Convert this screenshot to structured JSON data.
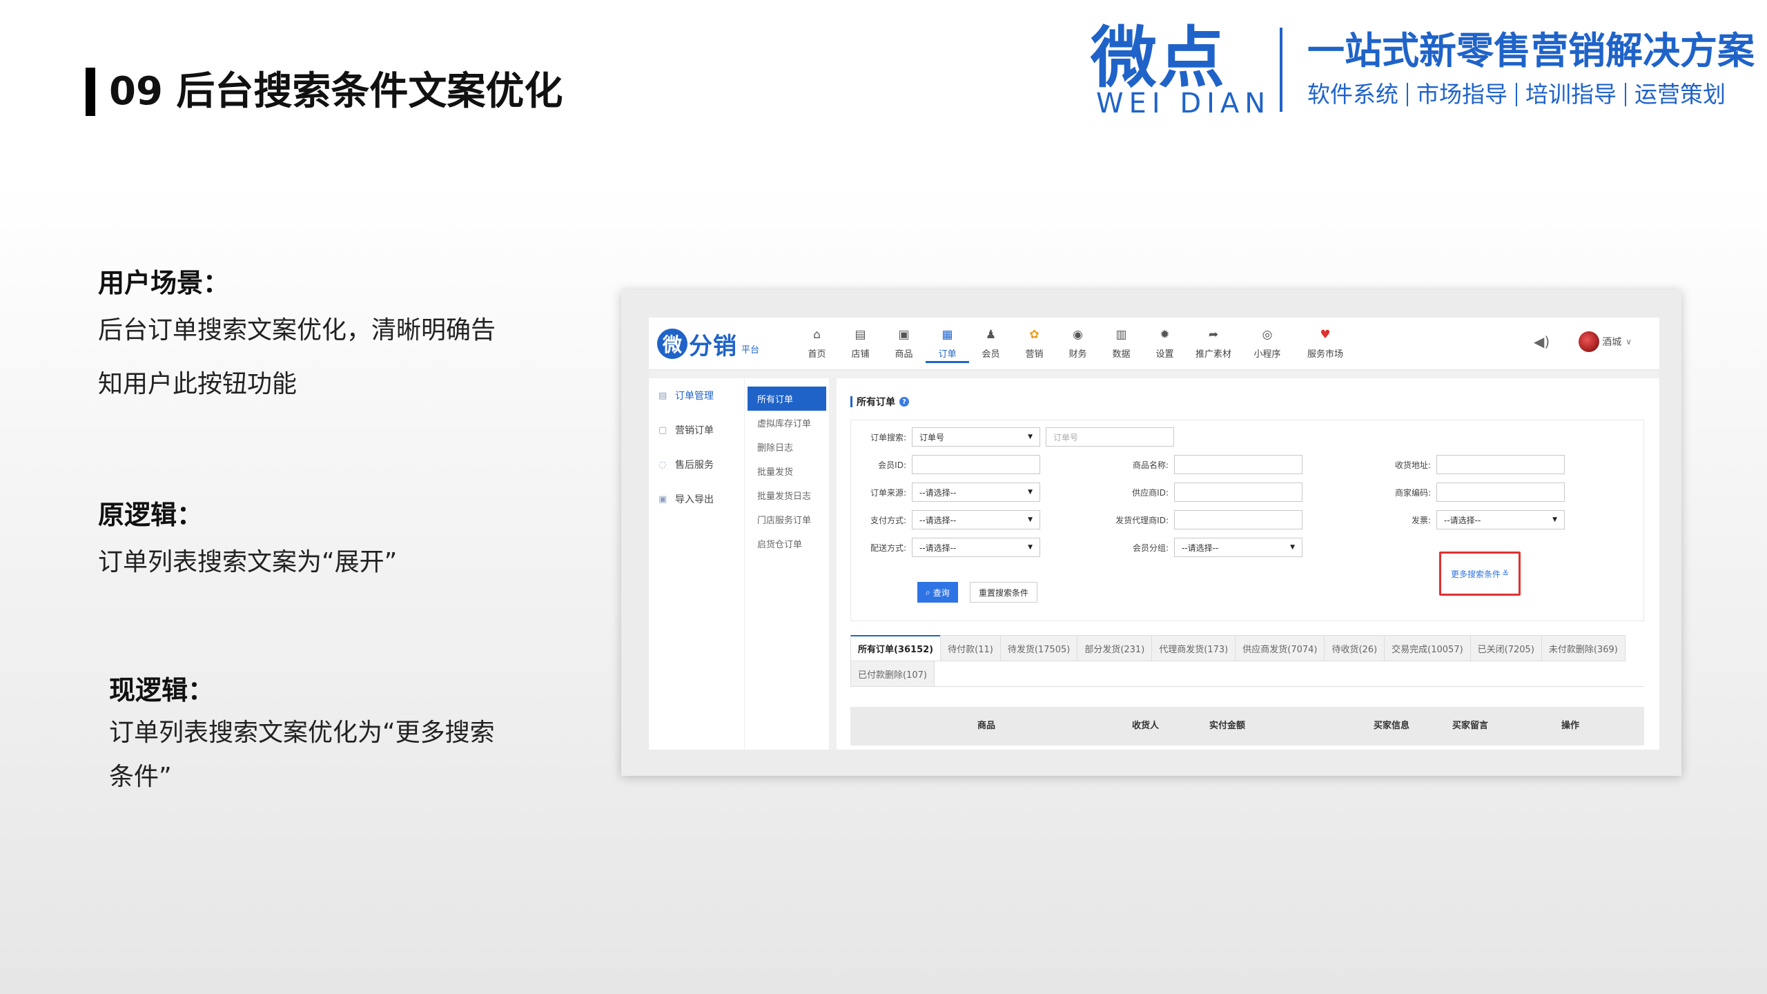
{
  "slide": {
    "title": "09 后台搜索条件文案优化"
  },
  "brand": {
    "logo_cn": "微点",
    "logo_en": "WEI DIAN",
    "slogan": "一站式新零售营销解决方案",
    "services": [
      "软件系统",
      "市场指导",
      "培训指导",
      "运营策划"
    ]
  },
  "sections": {
    "scene": {
      "heading": "用户场景：",
      "lines": [
        "后台订单搜索文案优化，清晰明确告",
        "知用户此按钮功能"
      ]
    },
    "old": {
      "heading": "原逻辑：",
      "lines": [
        "订单列表搜索文案为“展开”"
      ]
    },
    "new": {
      "heading": "现逻辑：",
      "lines": [
        "订单列表搜索文案优化为“更多搜索",
        "条件”"
      ]
    }
  },
  "app": {
    "logo": {
      "mark": "微",
      "name": "分销",
      "sub": "平台"
    },
    "nav": [
      {
        "label": "首页",
        "icon": "home-icon",
        "glyph": "⌂"
      },
      {
        "label": "店铺",
        "icon": "store-icon",
        "glyph": "▤"
      },
      {
        "label": "商品",
        "icon": "goods-icon",
        "glyph": "▣"
      },
      {
        "label": "订单",
        "icon": "order-icon",
        "glyph": "▦"
      },
      {
        "label": "会员",
        "icon": "member-icon",
        "glyph": "♟"
      },
      {
        "label": "营销",
        "icon": "marketing-icon",
        "glyph": "✿"
      },
      {
        "label": "财务",
        "icon": "finance-icon",
        "glyph": "◉"
      },
      {
        "label": "数据",
        "icon": "data-icon",
        "glyph": "▥"
      },
      {
        "label": "设置",
        "icon": "settings-icon",
        "glyph": "✹"
      },
      {
        "label": "推广素材",
        "icon": "share-icon",
        "glyph": "➦"
      },
      {
        "label": "小程序",
        "icon": "miniprogram-icon",
        "glyph": "◎"
      },
      {
        "label": "服务市场",
        "icon": "service-market-icon",
        "glyph": "♥"
      }
    ],
    "active_nav": "订单",
    "user_name": "酒城",
    "side1": [
      {
        "label": "订单管理",
        "icon": "order-manage-icon"
      },
      {
        "label": "营销订单",
        "icon": "marketing-order-icon"
      },
      {
        "label": "售后服务",
        "icon": "aftersale-icon"
      },
      {
        "label": "导入导出",
        "icon": "import-export-icon"
      }
    ],
    "side2": [
      "所有订单",
      "虚拟库存订单",
      "删除日志",
      "批量发货",
      "批量发货日志",
      "门店服务订单",
      "启货仓订单"
    ],
    "page_title": "所有订单",
    "filters": {
      "order_search_label": "订单搜索:",
      "order_search_type": "订单号",
      "order_search_placeholder": "订单号",
      "member_id_label": "会员ID:",
      "goods_name_label": "商品名称:",
      "address_label": "收货地址:",
      "order_source_label": "订单来源:",
      "order_source_value": "--请选择--",
      "supplier_id_label": "供应商ID:",
      "merchant_code_label": "商家编码:",
      "pay_method_label": "支付方式:",
      "pay_method_value": "--请选择--",
      "agent_id_label": "发货代理商ID:",
      "invoice_label": "发票:",
      "invoice_value": "--请选择--",
      "delivery_label": "配送方式:",
      "delivery_value": "--请选择--",
      "member_group_label": "会员分组:",
      "member_group_value": "--请选择--",
      "search_button": "查询",
      "reset_button": "重置搜索条件",
      "more_conditions": "更多搜索条件"
    },
    "tabs": [
      "所有订单(36152)",
      "待付款(11)",
      "待发货(17505)",
      "部分发货(231)",
      "代理商发货(173)",
      "供应商发货(7074)",
      "待收货(26)",
      "交易完成(10057)",
      "已关闭(7205)",
      "未付款删除(369)",
      "已付款删除(107)"
    ],
    "table_headers": [
      "商品",
      "收货人",
      "实付金额",
      "买家信息",
      "买家留言",
      "操作"
    ]
  }
}
